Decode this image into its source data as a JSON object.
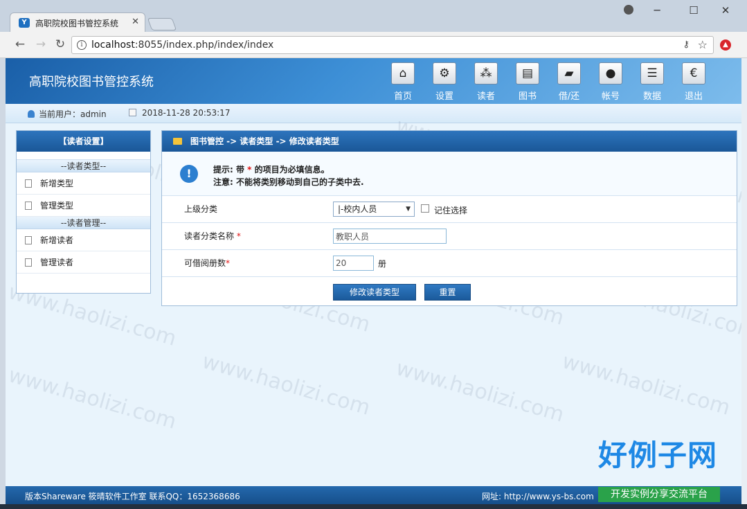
{
  "browser": {
    "tab_title": "高职院校图书管控系统",
    "tab_close": "✕",
    "url_host": "localhost",
    "url_rest": ":8055/index.php/index/index",
    "controls": {
      "minimize": "─",
      "maximize": "☐",
      "close": "✕"
    }
  },
  "app": {
    "title": "高职院校图书管控系统",
    "nav": [
      {
        "label": "首页",
        "icon": "home-icon",
        "glyph": "⌂"
      },
      {
        "label": "设置",
        "icon": "gears-icon",
        "glyph": "⚙"
      },
      {
        "label": "读者",
        "icon": "readers-icon",
        "glyph": "⁂"
      },
      {
        "label": "图书",
        "icon": "book-icon",
        "glyph": "▤"
      },
      {
        "label": "借/还",
        "icon": "folder-icon",
        "glyph": "▰"
      },
      {
        "label": "帐号",
        "icon": "account-icon",
        "glyph": "●"
      },
      {
        "label": "数据",
        "icon": "database-icon",
        "glyph": "☰"
      },
      {
        "label": "退出",
        "icon": "euro-icon",
        "glyph": "€"
      }
    ]
  },
  "status": {
    "user_text": "当前用户：admin",
    "datetime": "2018-11-28 20:53:17"
  },
  "sidebar": {
    "header": "【读者设置】",
    "section1": "--读者类型--",
    "link1": "新增类型",
    "link2": "管理类型",
    "section2": "--读者管理--",
    "link3": "新增读者",
    "link4": "管理读者"
  },
  "main": {
    "breadcrumb": "图书管控 -> 读者类型 -> 修改读者类型",
    "tip_prefix": "提示: 带",
    "tip_star": "*",
    "tip_suffix": "的项目为必填信息。",
    "note": "注意: 不能将类别移动到自己的子类中去.",
    "form": {
      "parent_label": "上级分类",
      "parent_value": "|-校内人员",
      "remember_label": "记住选择",
      "name_label": "读者分类名称",
      "name_value": "教职人员",
      "limit_label": "可借阅册数",
      "limit_value": "20",
      "limit_unit": "册",
      "required_mark": "*",
      "submit_label": "修改读者类型",
      "reset_label": "重置"
    }
  },
  "footer": {
    "left": "版本Shareware  筱晴软件工作室  联系QQ：1652368686",
    "right": "网址:   http://www.ys-bs.com"
  },
  "watermark": "www.haolizi.com",
  "brand": {
    "logo": "好例子网",
    "slogan": "开发实例分享交流平台"
  }
}
